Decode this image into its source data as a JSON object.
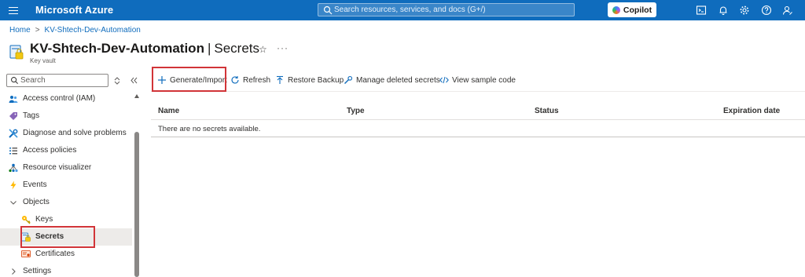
{
  "app": {
    "name": "Microsoft Azure"
  },
  "search": {
    "placeholder": "Search resources, services, and docs (G+/)"
  },
  "copilot": {
    "label": "Copilot"
  },
  "breadcrumb": {
    "home": "Home",
    "resource": "KV-Shtech-Dev-Automation",
    "separator": ">"
  },
  "page": {
    "resource_name": "KV-Shtech-Dev-Automation",
    "divider": "|",
    "section": "Secrets",
    "subtitle": "Key vault",
    "star": "☆",
    "more": "···"
  },
  "nav": {
    "search_placeholder": "Search",
    "items": [
      {
        "label": "Access control (IAM)",
        "icon": "people-icon"
      },
      {
        "label": "Tags",
        "icon": "tag-icon"
      },
      {
        "label": "Diagnose and solve problems",
        "icon": "wrench-icon"
      },
      {
        "label": "Access policies",
        "icon": "list-icon"
      },
      {
        "label": "Resource visualizer",
        "icon": "graph-icon"
      },
      {
        "label": "Events",
        "icon": "lightning-icon"
      },
      {
        "label": "Objects",
        "icon": "chevron-down-icon"
      },
      {
        "label": "Keys",
        "icon": "key-icon"
      },
      {
        "label": "Secrets",
        "icon": "secret-icon",
        "selected": true
      },
      {
        "label": "Certificates",
        "icon": "certificate-icon"
      },
      {
        "label": "Settings",
        "icon": "chevron-right-icon"
      }
    ]
  },
  "commands": {
    "generate": "Generate/Import",
    "refresh": "Refresh",
    "restore": "Restore Backup",
    "manage_deleted": "Manage deleted secrets",
    "view_sample": "View sample code"
  },
  "table": {
    "columns": [
      "Name",
      "Type",
      "Status",
      "Expiration date"
    ],
    "empty_message": "There are no secrets available."
  },
  "colors": {
    "accent": "#0f6cbd",
    "highlight": "#d13438"
  }
}
